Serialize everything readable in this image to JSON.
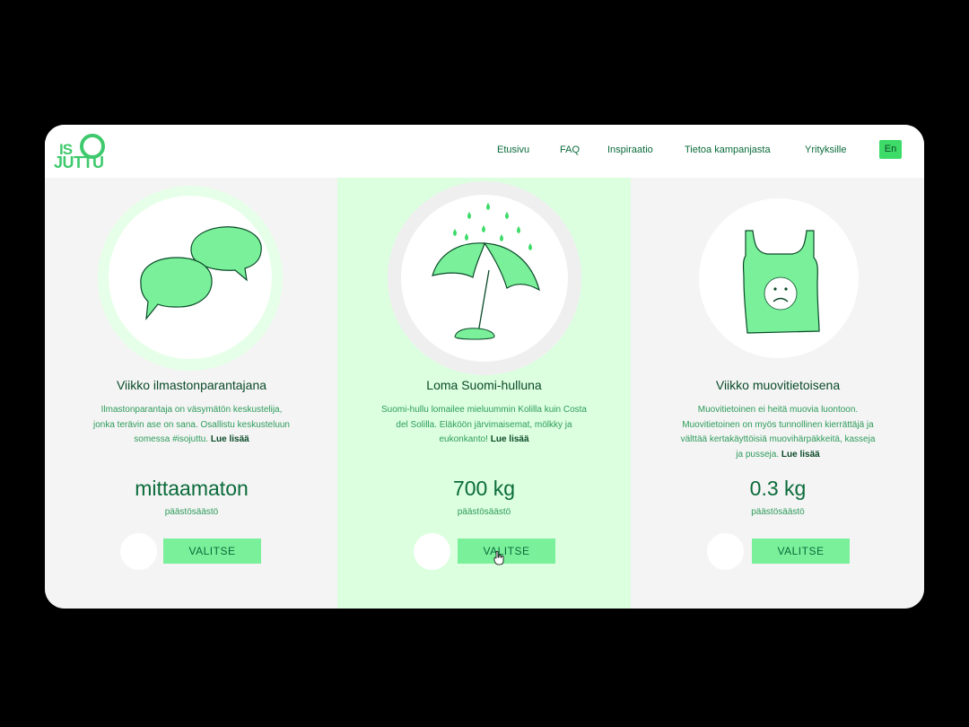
{
  "logo": {
    "top": "IS",
    "bottom": "JUTTU"
  },
  "nav": {
    "items": [
      "Etusivu",
      "FAQ",
      "Inspiraatio",
      "Tietoa kampanjasta",
      "Yrityksille"
    ],
    "lang": "En"
  },
  "cards": [
    {
      "title": "Viikko ilmastonparantajana",
      "desc": [
        "Ilmastonparantaja on väsymätön keskustelija,",
        "jonka terävin ase on sana. Osallistu keskusteluun",
        "somessa #isojuttu."
      ],
      "more": "Lue lisää",
      "value": "mittaamaton",
      "value_label": "päästösäästö",
      "button": "VALITSE",
      "icon": "speech-bubbles-icon"
    },
    {
      "title": "Loma Suomi-hulluna",
      "desc": [
        "Suomi-hullu lomailee mieluummin Kolilla kuin Costa",
        "del Solilla. Eläköön järvimaisemat, mölkky ja",
        "eukonkanto!"
      ],
      "more": "Lue lisää",
      "value": "700 kg",
      "value_label": "päästösäästö",
      "button": "VALITSE",
      "icon": "umbrella-rain-icon"
    },
    {
      "title": "Viikko muovitietoisena",
      "desc": [
        "Muovitietoinen ei heitä muovia luontoon.",
        "Muovitietoinen on myös tunnollinen kierrättäjä ja",
        "välttää kertakäyttöisiä muovihärpäkkeitä, kasseja",
        "ja pusseja."
      ],
      "more": "Lue lisää",
      "value": "0.3 kg",
      "value_label": "päästösäästö",
      "button": "VALITSE",
      "icon": "sad-plastic-bag-icon"
    }
  ],
  "colors": {
    "accent": "#3ddc68",
    "button": "#7af09a",
    "text_dark": "#0a4a28",
    "selected_bg": "#dcffe0"
  }
}
